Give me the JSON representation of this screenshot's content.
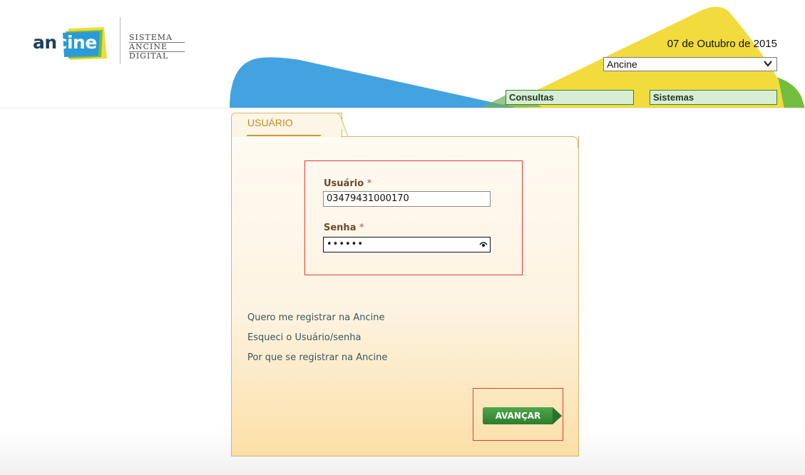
{
  "header": {
    "logo": {
      "prefix": "an",
      "highlight": "cine"
    },
    "system_name": [
      "SISTEMA",
      "ANCINE",
      "DIGITAL"
    ],
    "date": "07 de Outubro de 2015",
    "org_select": {
      "value": "Ancine"
    },
    "menu": [
      {
        "label": "Consultas"
      },
      {
        "label": "Sistemas"
      }
    ],
    "colors": {
      "blue": "#42a3e0",
      "yellow": "#f2db3c",
      "green": "#72bf3f"
    }
  },
  "login": {
    "tab_label": "USUÁRIO",
    "user_label": "Usuário",
    "password_label": "Senha",
    "required_marker": "*",
    "user_value": "03479431000170",
    "password_mask": "••••••",
    "links": [
      "Quero me registrar na Ancine",
      "Esqueci o Usuário/senha",
      "Por que se registrar na Ancine"
    ],
    "submit_label": "AVANÇAR"
  }
}
